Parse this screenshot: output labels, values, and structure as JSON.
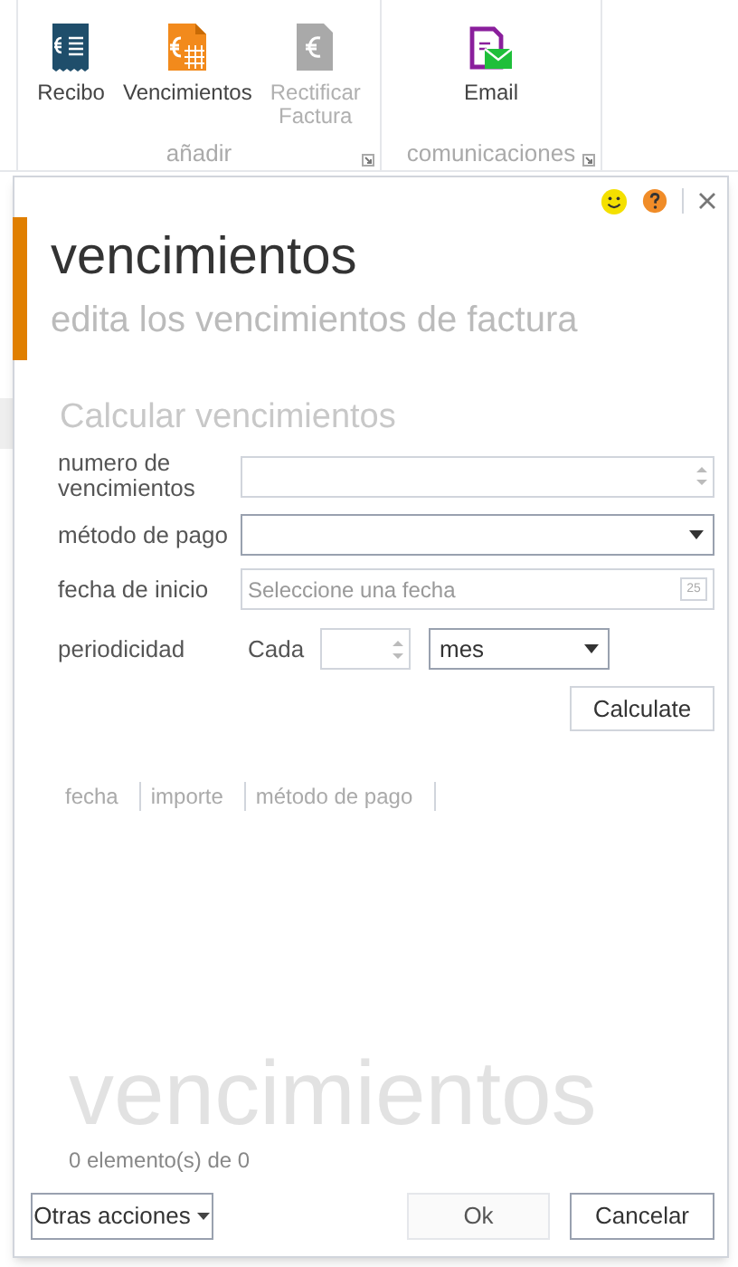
{
  "ribbon": {
    "groups": [
      {
        "label": "añadir",
        "buttons": [
          {
            "label": "Recibo",
            "kind": "receipt",
            "disabled": false
          },
          {
            "label": "Vencimientos",
            "kind": "calendar",
            "disabled": false
          },
          {
            "label": "Rectificar Factura",
            "kind": "invoice",
            "disabled": true
          }
        ]
      },
      {
        "label": "comunicaciones",
        "buttons": [
          {
            "label": "Email",
            "kind": "email",
            "disabled": false
          }
        ]
      }
    ]
  },
  "dialog": {
    "title": "vencimientos",
    "subtitle": "edita los vencimientos de factura",
    "section_title": "Calcular vencimientos",
    "fields": [
      {
        "kind": "spinner",
        "label": "numero de vencimientos"
      },
      {
        "kind": "select",
        "label": "método de pago"
      },
      {
        "kind": "date",
        "label": "fecha de inicio",
        "placeholder": "Seleccione una fecha",
        "calendar_day": "25"
      }
    ],
    "periodicity": {
      "label": "periodicidad",
      "prefix": "Cada",
      "unit": "mes"
    },
    "calculate_button": "Calculate",
    "columns": [
      "fecha",
      "importe",
      "método de pago"
    ],
    "watermark": "vencimientos",
    "count": "0 elemento(s) de 0",
    "more_actions": "Otras acciones",
    "ok_button": "Ok",
    "cancel_button": "Cancelar"
  }
}
